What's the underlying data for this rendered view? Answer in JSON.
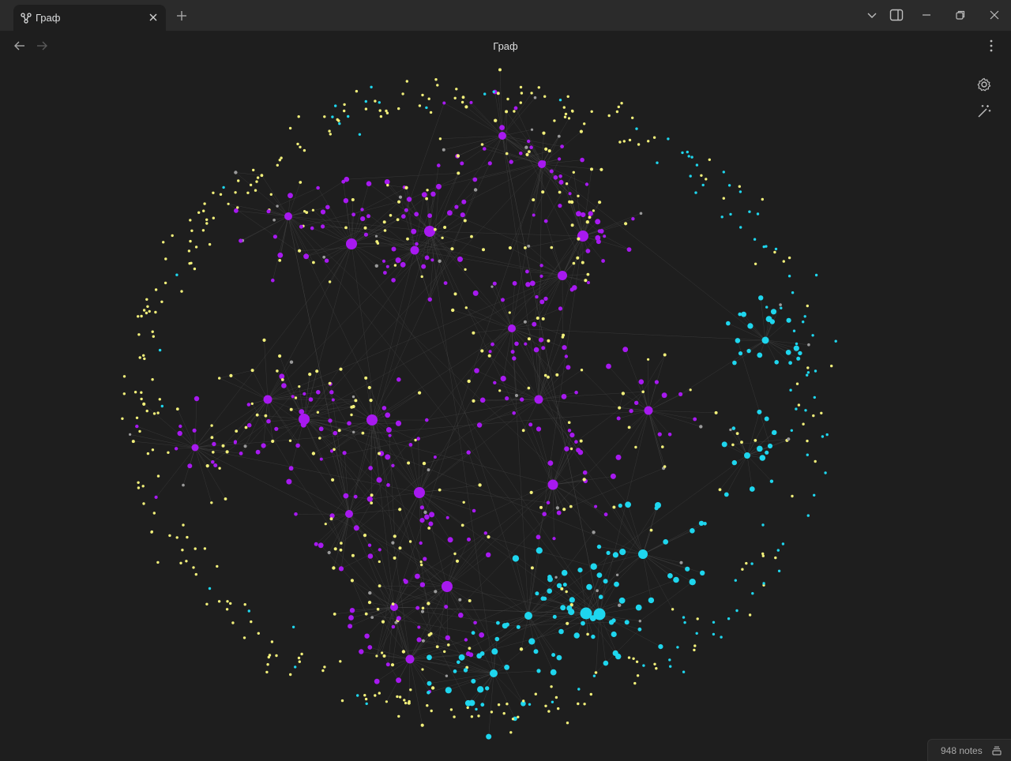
{
  "window": {
    "tab_title": "Граф",
    "view_title": "Граф"
  },
  "icons": {
    "tab": "graph-icon",
    "close": "close-icon",
    "new_tab": "plus-icon",
    "tab_list": "chevron-down-icon",
    "sidebar_toggle": "sidebar-icon",
    "minimize": "minimize-icon",
    "restore": "restore-icon",
    "window_close": "close-icon",
    "back": "arrow-left-icon",
    "forward": "arrow-right-icon",
    "more": "more-vertical-icon",
    "settings": "gear-icon",
    "animate": "magic-wand-icon",
    "status": "layers-icon"
  },
  "status": {
    "notes_count": "948 notes"
  },
  "colors": {
    "background": "#1e1e1e",
    "titlebar": "#2b2b2b",
    "node_purple": "#a719f0",
    "node_cyan": "#1ed6ee",
    "node_yellow": "#f2f07a",
    "node_grey": "#9a9a9a",
    "edge": "#4a4a4a"
  }
}
